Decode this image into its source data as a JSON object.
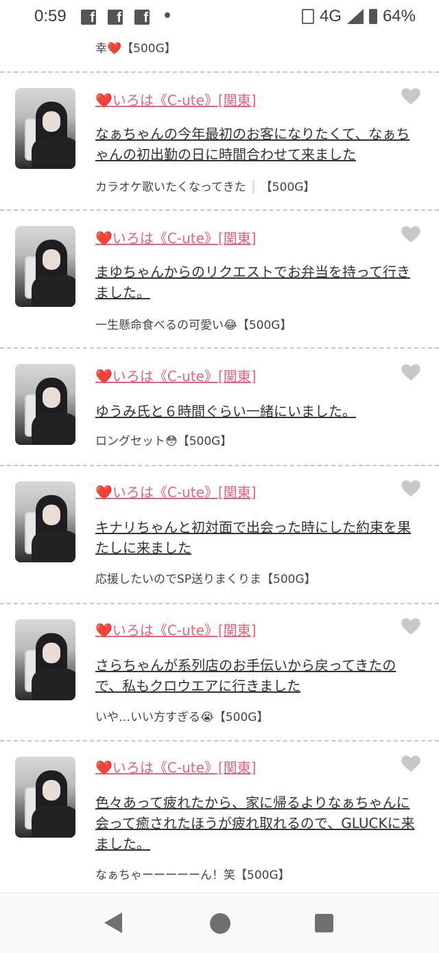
{
  "status_bar": {
    "time": "0:59",
    "network": "4G",
    "battery": "64%",
    "fb_glyph": "f"
  },
  "top_partial": {
    "comment": "幸❤️【500G】"
  },
  "entries": [
    {
      "name": "❤️いろは《C-ute》[関東]",
      "message": "なぁちゃんの今年最初のお客になりたくて、なぁちゃんの初出勤の日に時間合わせて来ました",
      "comment": "カラオケ歌いたくなってきた❕【500G】"
    },
    {
      "name": "❤️いろは《C-ute》[関東]",
      "message": "まゆちゃんからのリクエストでお弁当を持って行きました。",
      "comment": "一生懸命食べるの可愛い😂【500G】"
    },
    {
      "name": "❤️いろは《C-ute》[関東]",
      "message": "ゆうみ氏と６時間ぐらい一緒にいました。",
      "comment": "ロングセット😳【500G】"
    },
    {
      "name": "❤️いろは《C-ute》[関東]",
      "message": "キナリちゃんと初対面で出会った時にした約束を果たしに来ました",
      "comment": "応援したいのでSP送りまくりま【500G】"
    },
    {
      "name": "❤️いろは《C-ute》[関東]",
      "message": "さらちゃんが系列店のお手伝いから戻ってきたので、私もクロウエアに行きました",
      "comment": "いや…いい方すぎる😭【500G】"
    },
    {
      "name": "❤️いろは《C-ute》[関東]",
      "message": "色々あって疲れたから、家に帰るよりなぁちゃんに会って癒されたほうが疲れ取れるので、GLUCKに来ました。",
      "comment": "なぁちゃーーーーーん！笑【500G】"
    }
  ],
  "icons": {
    "like": "heart-icon",
    "back": "back-icon",
    "home": "home-icon",
    "recents": "recents-icon"
  },
  "colors": {
    "name_link": "#e8627a",
    "like_heart": "#c8c8c8",
    "divider": "#c8c8c8"
  }
}
